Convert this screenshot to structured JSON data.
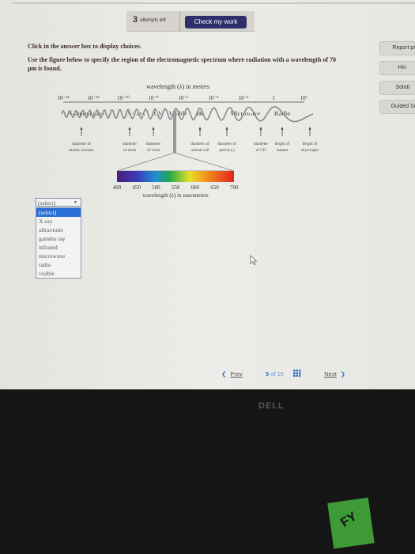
{
  "toolbar": {
    "attempts_count": "3",
    "attempts_label": "attempts left",
    "check_label": "Check my work"
  },
  "side_buttons": [
    {
      "label": "Report pr"
    },
    {
      "label": "Hin"
    },
    {
      "label": "Soluti"
    },
    {
      "label": "Guided So"
    }
  ],
  "instruction": "Click in the answer box to display choices.",
  "question": "Use the figure below to specify the region of the electromagnetic spectrum where radiation with a wavelength of 70 µm is found.",
  "figure": {
    "top_axis_title": "wavelength (λ) in meters",
    "top_ticks": [
      "10⁻¹⁴",
      "10⁻¹²",
      "10⁻¹⁰",
      "10⁻⁸",
      "10⁻⁶",
      "10⁻⁴",
      "10⁻²",
      "1",
      "10²"
    ],
    "regions": [
      "Gamma rays",
      "X-rays",
      "UV",
      "Visible",
      "IR",
      "Microwave",
      "Radio"
    ],
    "captions": [
      [
        "diameter of",
        "atomic nucleus"
      ],
      [
        "diameter",
        "of atom"
      ],
      [
        "diameter",
        "of virus"
      ],
      [
        "diameter of",
        "animal cell"
      ],
      [
        "diameter of",
        "period (.)"
      ],
      [
        "diameter",
        "of CD"
      ],
      [
        "height of",
        "human"
      ],
      [
        "height of",
        "skyscraper"
      ]
    ],
    "nm_ticks": [
      "400",
      "450",
      "500",
      "550",
      "600",
      "650",
      "700"
    ],
    "nm_axis_title": "wavelength (λ) in nanometers"
  },
  "answer_select": {
    "selected": "(select)",
    "options": [
      "(select)",
      "X-ray",
      "ultraviolet",
      "gamma ray",
      "infrared",
      "microwave",
      "radio",
      "visible"
    ],
    "highlight_color": "#2a6fd6"
  },
  "nav": {
    "prev_label": "Prev",
    "current": "5",
    "of_label": "of",
    "total": "15",
    "next_label": "Next"
  },
  "monitor": {
    "brand": "DELL"
  },
  "sticker": {
    "text": "FY"
  },
  "colors": {
    "button": "#2e2f6c",
    "link": "#2f73c9"
  }
}
